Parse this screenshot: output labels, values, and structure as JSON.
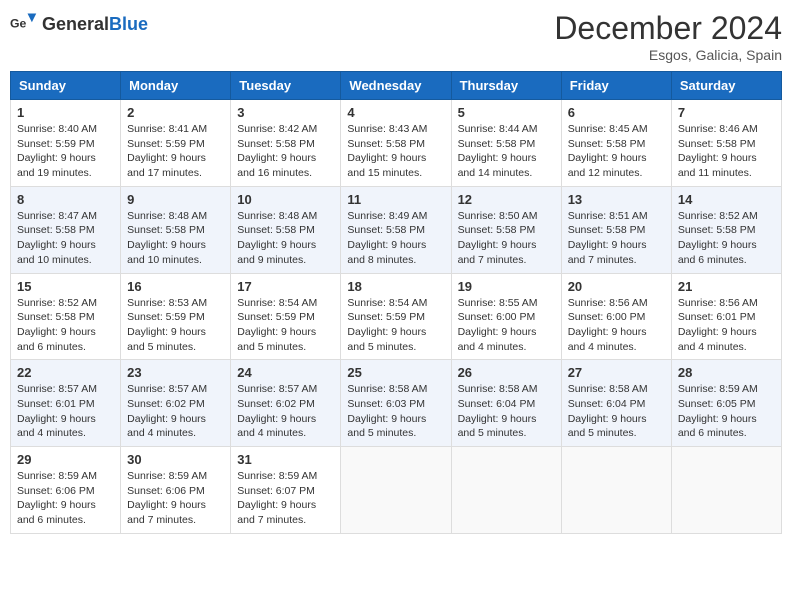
{
  "header": {
    "logo_general": "General",
    "logo_blue": "Blue",
    "title": "December 2024",
    "location": "Esgos, Galicia, Spain"
  },
  "weekdays": [
    "Sunday",
    "Monday",
    "Tuesday",
    "Wednesday",
    "Thursday",
    "Friday",
    "Saturday"
  ],
  "weeks": [
    [
      {
        "day": "1",
        "info": "Sunrise: 8:40 AM\nSunset: 5:59 PM\nDaylight: 9 hours\nand 19 minutes."
      },
      {
        "day": "2",
        "info": "Sunrise: 8:41 AM\nSunset: 5:59 PM\nDaylight: 9 hours\nand 17 minutes."
      },
      {
        "day": "3",
        "info": "Sunrise: 8:42 AM\nSunset: 5:58 PM\nDaylight: 9 hours\nand 16 minutes."
      },
      {
        "day": "4",
        "info": "Sunrise: 8:43 AM\nSunset: 5:58 PM\nDaylight: 9 hours\nand 15 minutes."
      },
      {
        "day": "5",
        "info": "Sunrise: 8:44 AM\nSunset: 5:58 PM\nDaylight: 9 hours\nand 14 minutes."
      },
      {
        "day": "6",
        "info": "Sunrise: 8:45 AM\nSunset: 5:58 PM\nDaylight: 9 hours\nand 12 minutes."
      },
      {
        "day": "7",
        "info": "Sunrise: 8:46 AM\nSunset: 5:58 PM\nDaylight: 9 hours\nand 11 minutes."
      }
    ],
    [
      {
        "day": "8",
        "info": "Sunrise: 8:47 AM\nSunset: 5:58 PM\nDaylight: 9 hours\nand 10 minutes."
      },
      {
        "day": "9",
        "info": "Sunrise: 8:48 AM\nSunset: 5:58 PM\nDaylight: 9 hours\nand 10 minutes."
      },
      {
        "day": "10",
        "info": "Sunrise: 8:48 AM\nSunset: 5:58 PM\nDaylight: 9 hours\nand 9 minutes."
      },
      {
        "day": "11",
        "info": "Sunrise: 8:49 AM\nSunset: 5:58 PM\nDaylight: 9 hours\nand 8 minutes."
      },
      {
        "day": "12",
        "info": "Sunrise: 8:50 AM\nSunset: 5:58 PM\nDaylight: 9 hours\nand 7 minutes."
      },
      {
        "day": "13",
        "info": "Sunrise: 8:51 AM\nSunset: 5:58 PM\nDaylight: 9 hours\nand 7 minutes."
      },
      {
        "day": "14",
        "info": "Sunrise: 8:52 AM\nSunset: 5:58 PM\nDaylight: 9 hours\nand 6 minutes."
      }
    ],
    [
      {
        "day": "15",
        "info": "Sunrise: 8:52 AM\nSunset: 5:58 PM\nDaylight: 9 hours\nand 6 minutes."
      },
      {
        "day": "16",
        "info": "Sunrise: 8:53 AM\nSunset: 5:59 PM\nDaylight: 9 hours\nand 5 minutes."
      },
      {
        "day": "17",
        "info": "Sunrise: 8:54 AM\nSunset: 5:59 PM\nDaylight: 9 hours\nand 5 minutes."
      },
      {
        "day": "18",
        "info": "Sunrise: 8:54 AM\nSunset: 5:59 PM\nDaylight: 9 hours\nand 5 minutes."
      },
      {
        "day": "19",
        "info": "Sunrise: 8:55 AM\nSunset: 6:00 PM\nDaylight: 9 hours\nand 4 minutes."
      },
      {
        "day": "20",
        "info": "Sunrise: 8:56 AM\nSunset: 6:00 PM\nDaylight: 9 hours\nand 4 minutes."
      },
      {
        "day": "21",
        "info": "Sunrise: 8:56 AM\nSunset: 6:01 PM\nDaylight: 9 hours\nand 4 minutes."
      }
    ],
    [
      {
        "day": "22",
        "info": "Sunrise: 8:57 AM\nSunset: 6:01 PM\nDaylight: 9 hours\nand 4 minutes."
      },
      {
        "day": "23",
        "info": "Sunrise: 8:57 AM\nSunset: 6:02 PM\nDaylight: 9 hours\nand 4 minutes."
      },
      {
        "day": "24",
        "info": "Sunrise: 8:57 AM\nSunset: 6:02 PM\nDaylight: 9 hours\nand 4 minutes."
      },
      {
        "day": "25",
        "info": "Sunrise: 8:58 AM\nSunset: 6:03 PM\nDaylight: 9 hours\nand 5 minutes."
      },
      {
        "day": "26",
        "info": "Sunrise: 8:58 AM\nSunset: 6:04 PM\nDaylight: 9 hours\nand 5 minutes."
      },
      {
        "day": "27",
        "info": "Sunrise: 8:58 AM\nSunset: 6:04 PM\nDaylight: 9 hours\nand 5 minutes."
      },
      {
        "day": "28",
        "info": "Sunrise: 8:59 AM\nSunset: 6:05 PM\nDaylight: 9 hours\nand 6 minutes."
      }
    ],
    [
      {
        "day": "29",
        "info": "Sunrise: 8:59 AM\nSunset: 6:06 PM\nDaylight: 9 hours\nand 6 minutes."
      },
      {
        "day": "30",
        "info": "Sunrise: 8:59 AM\nSunset: 6:06 PM\nDaylight: 9 hours\nand 7 minutes."
      },
      {
        "day": "31",
        "info": "Sunrise: 8:59 AM\nSunset: 6:07 PM\nDaylight: 9 hours\nand 7 minutes."
      },
      {
        "day": "",
        "info": ""
      },
      {
        "day": "",
        "info": ""
      },
      {
        "day": "",
        "info": ""
      },
      {
        "day": "",
        "info": ""
      }
    ]
  ]
}
